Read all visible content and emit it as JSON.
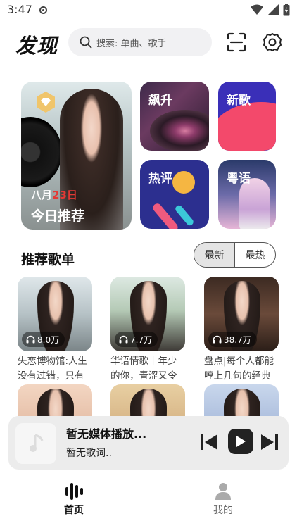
{
  "status_bar": {
    "time": "3:47"
  },
  "header": {
    "title": "发现",
    "search_placeholder": "搜索: 单曲、歌手",
    "scan_icon": "scan-icon",
    "settings_icon": "gear-icon"
  },
  "featured": {
    "daily": {
      "month": "八月",
      "day": "23日",
      "label": "今日推荐",
      "badge_icon": "diamond-icon"
    },
    "tiles": [
      {
        "label": "飙升"
      },
      {
        "label": "新歌"
      },
      {
        "label": "热评"
      },
      {
        "label": "粤语"
      }
    ]
  },
  "playlists": {
    "title": "推荐歌单",
    "tabs": [
      "最新",
      "最热"
    ],
    "active_tab": "最新",
    "items": [
      {
        "count": "8.0万",
        "title": "失恋博物馆:人生没有过错，只有"
      },
      {
        "count": "7.7万",
        "title": "华语情歌｜年少的你，青涩又令"
      },
      {
        "count": "38.7万",
        "title": "盘点|每个人都能哼上几句的经典"
      },
      {
        "count": "",
        "title": ""
      },
      {
        "count": "",
        "title": ""
      },
      {
        "count": "",
        "title": ""
      }
    ]
  },
  "player": {
    "title": "暂无媒体播放...",
    "lyrics": "暂无歌词.."
  },
  "tabbar": {
    "home": "首页",
    "me": "我的"
  }
}
